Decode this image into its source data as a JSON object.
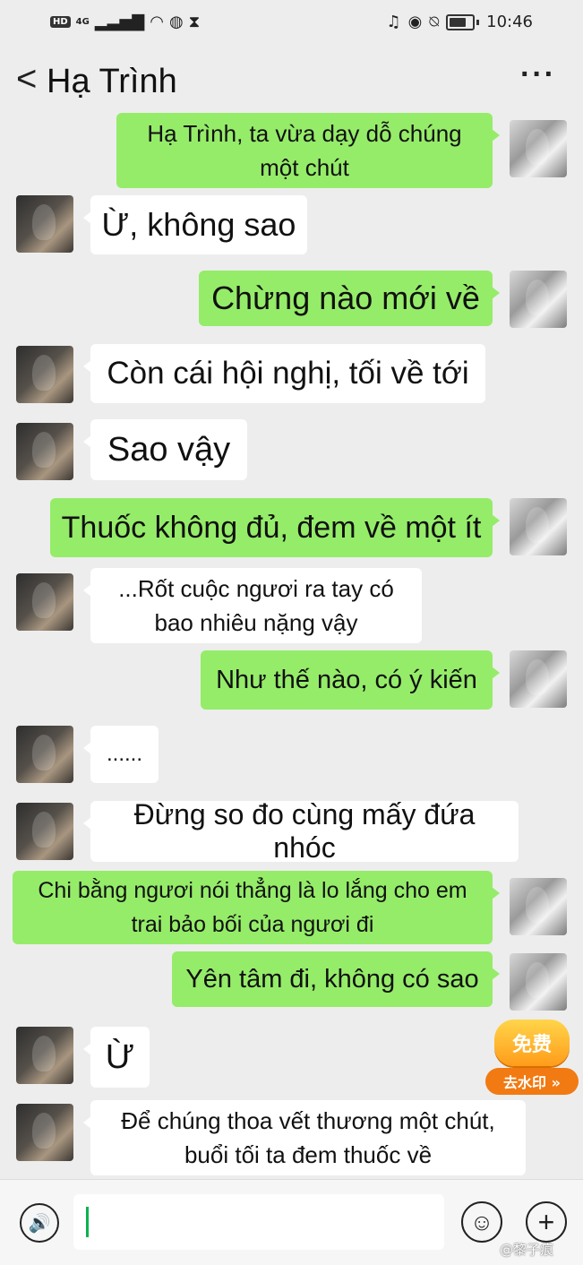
{
  "status_bar": {
    "left_badges": [
      "HD",
      "4G"
    ],
    "time": "10:46",
    "icons": [
      "signal-icon",
      "wifi-icon",
      "globe-icon",
      "hourglass-icon",
      "headphones-icon",
      "eye-icon",
      "bell-off-icon",
      "battery-icon"
    ]
  },
  "header": {
    "back_glyph": "<",
    "title": "Hạ Trình",
    "more_glyph": "···"
  },
  "messages": [
    {
      "from": "self",
      "text": "Hạ Trình, ta vừa dạy dỗ chúng một chút"
    },
    {
      "from": "other",
      "text": "Ừ, không sao"
    },
    {
      "from": "self",
      "text": "Chừng nào mới về"
    },
    {
      "from": "other",
      "text": "Còn cái hội nghị, tối về tới"
    },
    {
      "from": "other",
      "text": "Sao vậy"
    },
    {
      "from": "self",
      "text": "Thuốc không đủ, đem về một ít"
    },
    {
      "from": "other",
      "text": "...Rốt cuộc ngươi ra tay có bao nhiêu nặng vậy"
    },
    {
      "from": "self",
      "text": "Như thế nào, có ý kiến"
    },
    {
      "from": "other",
      "text": "......"
    },
    {
      "from": "other",
      "text": "Đừng so đo cùng mấy đứa nhóc"
    },
    {
      "from": "self",
      "text": "Chi bằng ngươi nói thẳng là lo lắng cho em trai bảo bối của ngươi đi"
    },
    {
      "from": "self",
      "text": "Yên tâm đi, không có sao"
    },
    {
      "from": "other",
      "text": "Ừ"
    },
    {
      "from": "other",
      "text": "Để chúng thoa vết thương một chút, buổi tối ta đem thuốc về"
    }
  ],
  "promo_badge": {
    "top": "免费",
    "bottom": "去水印 »"
  },
  "input_bar": {
    "value": "",
    "voice_glyph": "🔊",
    "emoji_glyph": "☺",
    "plus_glyph": "+"
  },
  "watermark": "@黎子痕"
}
